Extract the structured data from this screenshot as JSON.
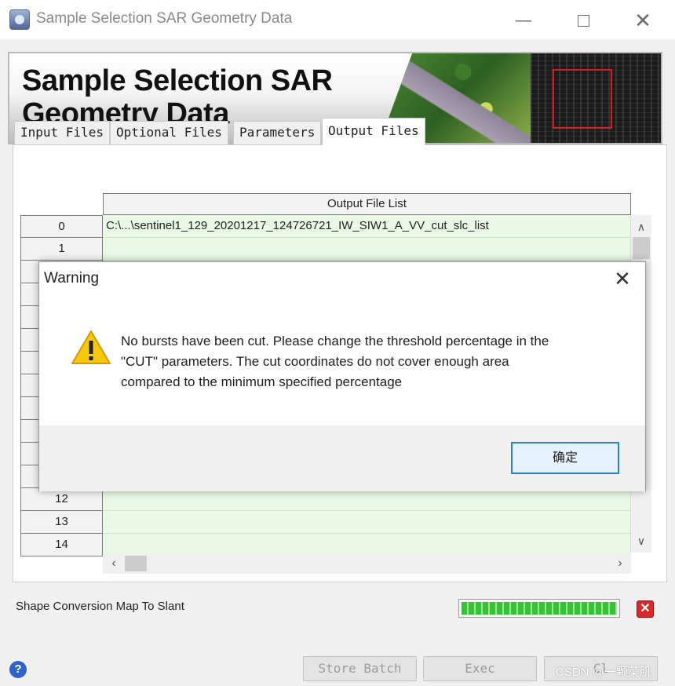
{
  "window": {
    "title": "Sample Selection SAR Geometry Data",
    "controls": {
      "minimize": "—",
      "maximize": "",
      "close": "✕"
    }
  },
  "banner": {
    "title_line1": "Sample Selection SAR",
    "title_line2": "Geometry Data"
  },
  "tabs": [
    {
      "label": "Input Files",
      "active": false
    },
    {
      "label": "Optional Files",
      "active": false
    },
    {
      "label": "Parameters",
      "active": false
    },
    {
      "label": "Output Files",
      "active": true
    }
  ],
  "table": {
    "column_header": "Output File List",
    "rows": [
      {
        "index": "0",
        "value": "C:\\...\\sentinel1_129_20201217_124726721_IW_SIW1_A_VV_cut_slc_list"
      },
      {
        "index": "1",
        "value": ""
      },
      {
        "index": "12",
        "value": ""
      },
      {
        "index": "13",
        "value": ""
      },
      {
        "index": "14",
        "value": ""
      }
    ],
    "cell_color": "#e9f9e6"
  },
  "status": {
    "label": "Shape Conversion Map To Slant",
    "progress_fraction": 1.0,
    "progress_color": "#35c335"
  },
  "buttons": {
    "store_batch": "Store Batch",
    "exec": "Exec",
    "close": "Cl",
    "help": "?"
  },
  "dialog": {
    "title": "Warning",
    "close": "✕",
    "message_line1": "No bursts have been cut. Please change the threshold percentage in the",
    "message_line2": "\"CUT\" parameters. The cut coordinates do not cover enough area",
    "message_line3": "compared to the minimum specified percentage",
    "ok_label": "确定",
    "icon": "warning-triangle-icon"
  },
  "watermark": "CSDN @一颗菜肌"
}
